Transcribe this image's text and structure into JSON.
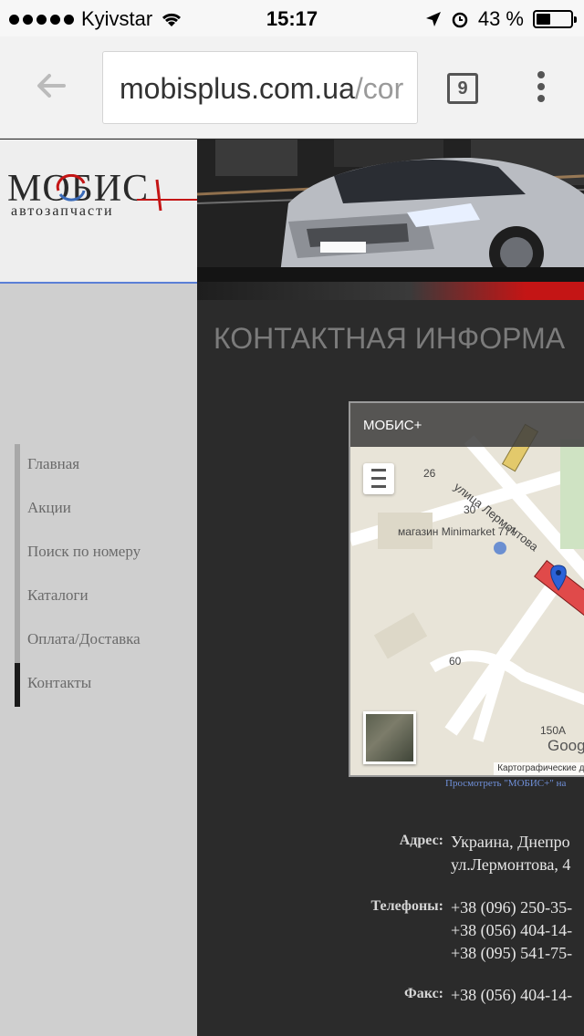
{
  "status_bar": {
    "carrier": "Kyivstar",
    "time": "15:17",
    "battery": "43 %",
    "battery_level": 0.43
  },
  "browser": {
    "url_main": "mobisplus.com.ua",
    "url_rest": "/cor",
    "tab_count": "9"
  },
  "logo": {
    "title": "МОБИС",
    "subtitle": "автозапчасти"
  },
  "nav": {
    "items": [
      {
        "label": "Главная"
      },
      {
        "label": "Акции"
      },
      {
        "label": "Поиск по номеру"
      },
      {
        "label": "Каталоги"
      },
      {
        "label": "Оплата/Доставка"
      },
      {
        "label": "Контакты"
      }
    ],
    "active": "Контакты"
  },
  "page": {
    "title": "КОНТАКТНАЯ ИНФОРМА"
  },
  "map": {
    "header": "МОБИС+",
    "labels": [
      "26",
      "30",
      "магазин Minimarket 777",
      "улица Лермонтова",
      "60",
      "150А",
      "Goog"
    ],
    "attribution": "Картографические да",
    "view_link": "Просмотреть \"МОБИС+\" на"
  },
  "contacts": {
    "address_label": "Адрес:",
    "address_lines": [
      "Украина, Днепро",
      "ул.Лермонтова, 4"
    ],
    "phones_label": "Телефоны:",
    "phones": [
      "+38 (096) 250-35-",
      "+38 (056) 404-14-",
      "+38 (095) 541-75-"
    ],
    "fax_label": "Факс:",
    "fax": "+38 (056) 404-14-"
  },
  "colors": {
    "accent_red": "#c41515",
    "link_blue": "#6f8fd8",
    "sidebar_border": "#5b7fd6"
  }
}
